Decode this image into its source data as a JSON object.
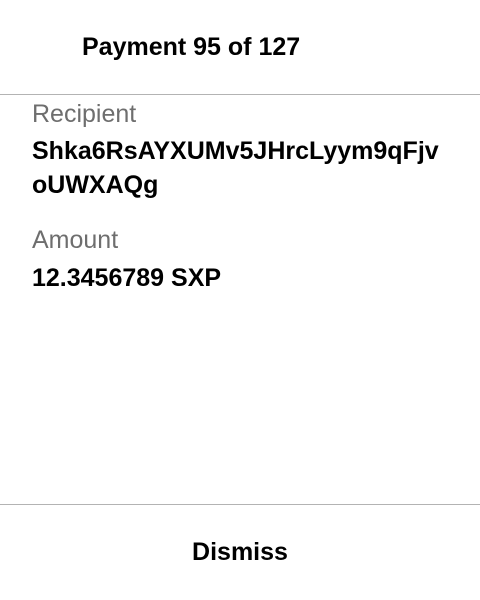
{
  "header": {
    "title": "Payment 95 of 127"
  },
  "payment": {
    "recipient_label": "Recipient",
    "recipient_value": "Shka6RsAYXUMv5JHrcLyym9qFjvoUWXAQg",
    "amount_label": "Amount",
    "amount_value": "12.3456789 SXP"
  },
  "footer": {
    "dismiss_label": "Dismiss"
  },
  "colors": {
    "background": "#ffffff",
    "text": "#000000",
    "label_text": "#6e6e6e",
    "divider": "#b3b3b3"
  }
}
